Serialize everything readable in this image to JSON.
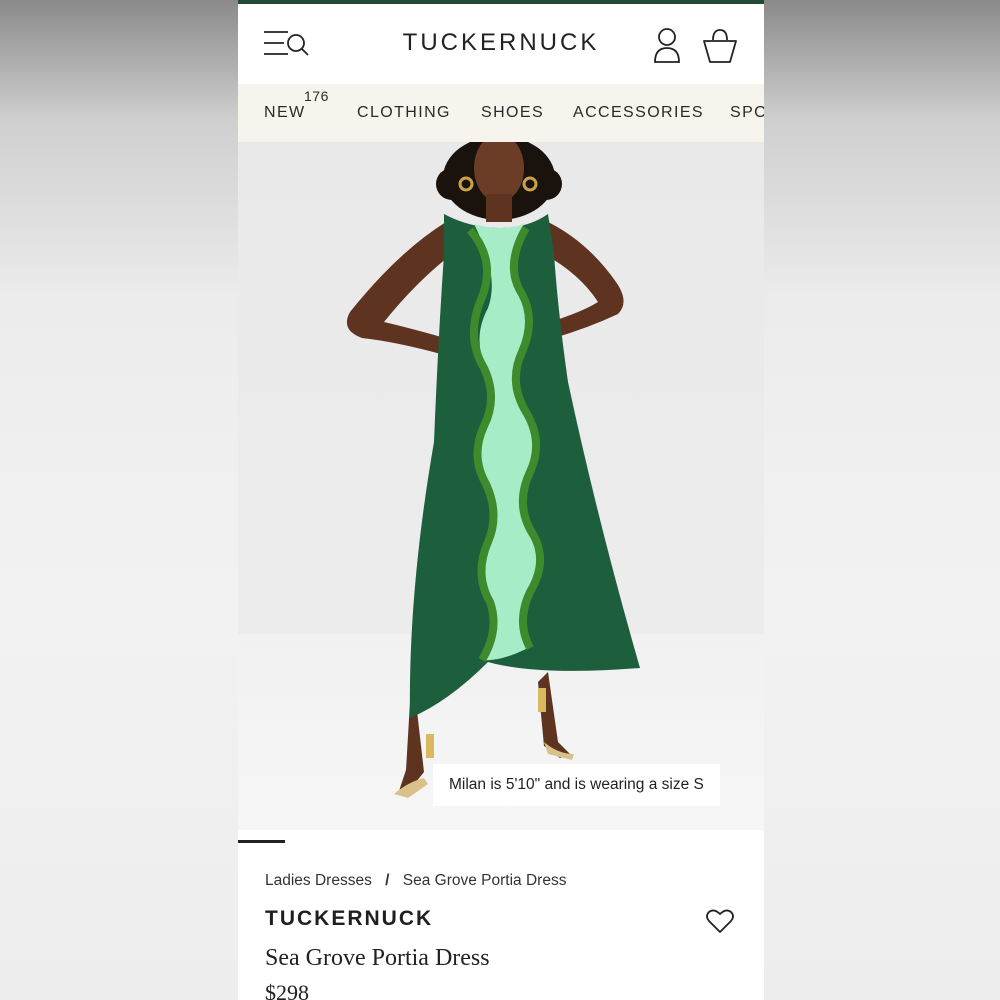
{
  "header": {
    "brand_logo": "TUCKERNUCK",
    "menu_icon": "menu-search-icon",
    "account_icon": "account-icon",
    "bag_icon": "bag-icon"
  },
  "nav": {
    "items": [
      {
        "label": "NEW",
        "badge": "176"
      },
      {
        "label": "CLOTHING"
      },
      {
        "label": "SHOES"
      },
      {
        "label": "ACCESSORIES"
      },
      {
        "label": "SPO"
      }
    ]
  },
  "hero": {
    "caption": "Milan is 5'10\" and is wearing a size S"
  },
  "breadcrumb": {
    "items": [
      "Ladies Dresses",
      "Sea Grove Portia Dress"
    ],
    "separator": "/"
  },
  "product": {
    "brand": "TUCKERNUCK",
    "name": "Sea Grove Portia Dress",
    "price": "$298",
    "favorite_icon": "heart-icon"
  },
  "colors": {
    "accent_green": "#234a34",
    "nav_background": "#f7f4ee"
  }
}
